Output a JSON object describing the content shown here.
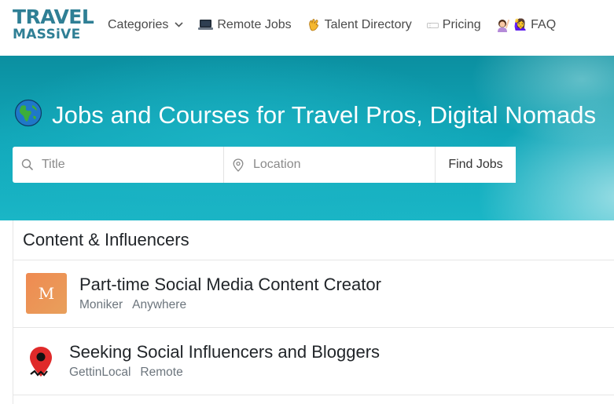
{
  "brand": {
    "logo_line1": "TRAVEL",
    "logo_line2": "MASSiVE",
    "color": "#2f7f95"
  },
  "nav": {
    "items": [
      {
        "label": "Categories",
        "icon": "chevron-down-icon"
      },
      {
        "label": "Remote Jobs",
        "icon": "laptop-icon"
      },
      {
        "label": "Talent Directory",
        "icon": "waving-hand-icon"
      },
      {
        "label": "Pricing",
        "icon": "ticket-icon"
      },
      {
        "label": "FAQ",
        "icon": "person-raising-hand-icon"
      }
    ],
    "faq_emoji": "🙋‍♀"
  },
  "hero": {
    "title": "Jobs and Courses for Travel Pros, Digital Nomads",
    "icon": "globe-icon"
  },
  "search": {
    "title_placeholder": "Title",
    "location_placeholder": "Location",
    "button_label": "Find Jobs"
  },
  "section": {
    "heading": "Content & Influencers",
    "jobs": [
      {
        "title": "Part-time Social Media Content Creator",
        "company": "Moniker",
        "location": "Anywhere",
        "logo_letter": "M"
      },
      {
        "title": "Seeking Social Influencers and Bloggers",
        "company": "GettinLocal",
        "location": "Remote"
      }
    ]
  },
  "colors": {
    "accent": "#2f7f95",
    "hero": "#12a9bb",
    "moniker": "#ef8a51",
    "pin": "#e02a2a"
  }
}
